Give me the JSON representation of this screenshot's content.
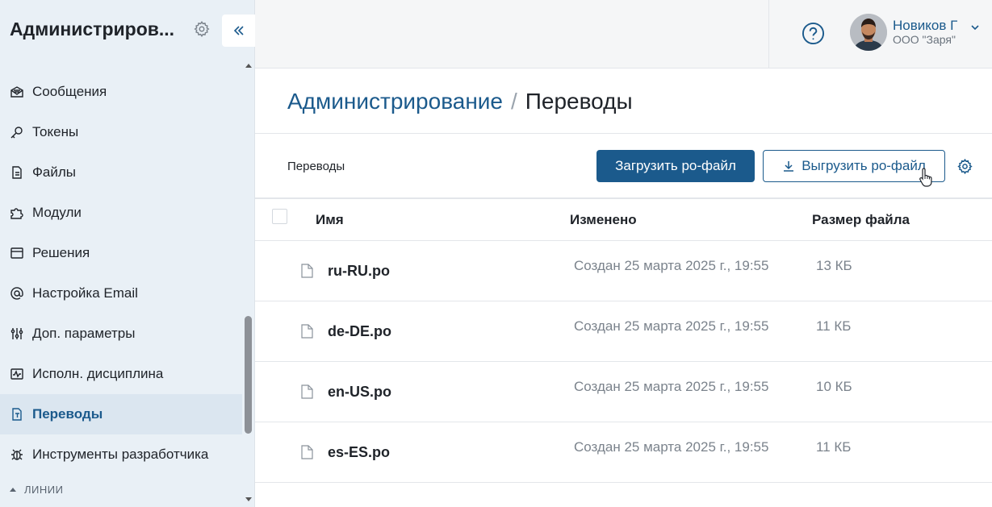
{
  "sidebar": {
    "title": "Администриров...",
    "items": [
      {
        "label": "Сообщения",
        "icon": "message-icon"
      },
      {
        "label": "Токены",
        "icon": "key-icon"
      },
      {
        "label": "Файлы",
        "icon": "file-icon"
      },
      {
        "label": "Модули",
        "icon": "puzzle-icon"
      },
      {
        "label": "Решения",
        "icon": "window-icon"
      },
      {
        "label": "Настройка Email",
        "icon": "at-icon"
      },
      {
        "label": "Доп. параметры",
        "icon": "sliders-icon"
      },
      {
        "label": "Исполн. дисциплина",
        "icon": "activity-icon"
      },
      {
        "label": "Переводы",
        "icon": "translate-file-icon",
        "active": true
      },
      {
        "label": "Инструменты разработчика",
        "icon": "bug-icon"
      }
    ],
    "section_label": "ЛИНИИ"
  },
  "header": {
    "user_name": "Новиков Г",
    "user_org": "ООО \"Заря\""
  },
  "page": {
    "breadcrumb_parent": "Администрирование",
    "breadcrumb_separator": "/",
    "breadcrumb_current": "Переводы"
  },
  "toolbar": {
    "title": "Переводы",
    "upload_label": "Загрузить po-файл",
    "download_label": "Выгрузить po-файл"
  },
  "table": {
    "columns": [
      "Имя",
      "Изменено",
      "Размер файла"
    ],
    "rows": [
      {
        "name": "ru-RU.po",
        "modified": "Создан 25 марта 2025 г., 19:55",
        "size": "13 КБ"
      },
      {
        "name": "de-DE.po",
        "modified": "Создан 25 марта 2025 г., 19:55",
        "size": "11 КБ"
      },
      {
        "name": "en-US.po",
        "modified": "Создан 25 марта 2025 г., 19:55",
        "size": "10 КБ"
      },
      {
        "name": "es-ES.po",
        "modified": "Создан 25 марта 2025 г., 19:55",
        "size": "11 КБ"
      }
    ]
  },
  "colors": {
    "accent": "#1b5a8c",
    "sidebar_bg": "#e9f0f6",
    "sidebar_active_bg": "#dbe6f0",
    "muted_text": "#7b838c"
  }
}
